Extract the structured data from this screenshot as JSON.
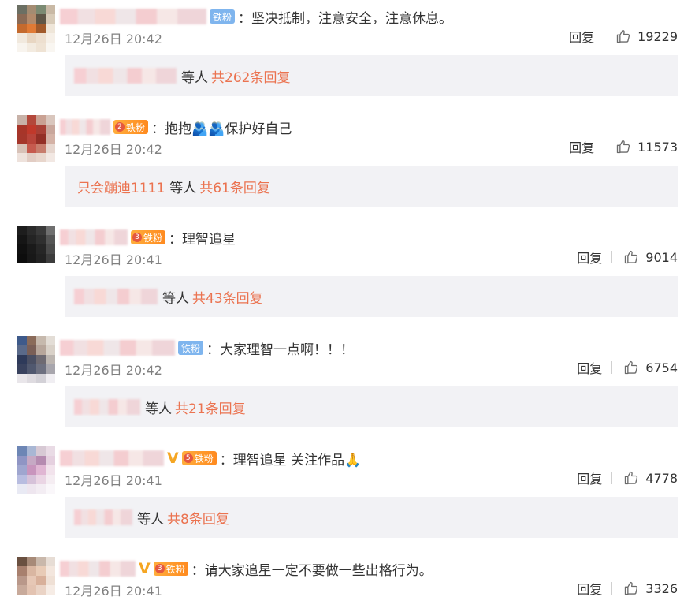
{
  "comments": [
    {
      "fan_label": "铁粉",
      "fan_style": "blue",
      "fan_level": "",
      "vip": "",
      "colon": "：",
      "text": "坚决抵制，注意安全，注意休息。",
      "time": "12月26日 20:42",
      "reply_label": "回复",
      "likes": "19229",
      "sub_nick": "",
      "sub_etc": "等人",
      "sub_total": "共262条回复",
      "avatar_colors": [
        "#6b6f63",
        "#a48c72",
        "#7b8a72",
        "#c9b9a5",
        "#8a6a55",
        "#b28a6b",
        "#5f5647",
        "#d8cbb8",
        "#c46a2e",
        "#e07a35",
        "#a15a2b",
        "#efe6d9",
        "#f1e9de",
        "#e8d6c2",
        "#eddfcf",
        "#f6f0e8",
        "#f8f4ee",
        "#f3ebe0",
        "#efe3d4",
        "#f9f6f1"
      ]
    },
    {
      "fan_label": "铁粉",
      "fan_style": "orange",
      "fan_level": "2",
      "vip": "",
      "colon": "：",
      "text": "抱抱🫂🫂保护好自己",
      "time": "12月26日 20:42",
      "reply_label": "回复",
      "likes": "11573",
      "sub_nick": "只会蹦迪1111",
      "sub_etc": "等人",
      "sub_total": "共61条回复",
      "avatar_colors": [
        "#c8b2a8",
        "#b3483b",
        "#c9a193",
        "#d9c6bd",
        "#a73529",
        "#c0392b",
        "#a84036",
        "#c9a79c",
        "#a5362b",
        "#b8443a",
        "#932f26",
        "#d4b2a6",
        "#d8c2b8",
        "#c65a4e",
        "#c77c6c",
        "#e6d6ce",
        "#eee2dc",
        "#e2cdc4",
        "#e8d6cc",
        "#f2e8e3"
      ]
    },
    {
      "fan_label": "铁粉",
      "fan_style": "orange",
      "fan_level": "3",
      "vip": "",
      "colon": "：",
      "text": "理智追星",
      "time": "12月26日 20:41",
      "reply_label": "回复",
      "likes": "9014",
      "sub_nick": "",
      "sub_etc": "等人",
      "sub_total": "共43条回复",
      "avatar_colors": [
        "#1d1d1d",
        "#2b2b2b",
        "#3a3a3a",
        "#6f6f6f",
        "#151515",
        "#242424",
        "#2f2f2f",
        "#555555",
        "#101010",
        "#1a1a1a",
        "#262626",
        "#4a4a4a",
        "#0d0d0d",
        "#181818",
        "#222222",
        "#3c3c3c",
        "#ffffff",
        "#ffffff",
        "#ffffff",
        "#ffffff"
      ]
    },
    {
      "fan_label": "铁粉",
      "fan_style": "blue",
      "fan_level": "",
      "vip": "",
      "colon": "：",
      "text": "大家理智一点啊！！！",
      "time": "12月26日 20:42",
      "reply_label": "回复",
      "likes": "6754",
      "sub_nick": "",
      "sub_etc": "等人",
      "sub_total": "共21条回复",
      "avatar_colors": [
        "#3e5a8a",
        "#8a6b5a",
        "#c6b9ad",
        "#e3ddd6",
        "#5a6a8a",
        "#7a5f57",
        "#b7a69b",
        "#d9d1c8",
        "#2e3a5a",
        "#4a4f63",
        "#6e6a72",
        "#bcb5b0",
        "#39425e",
        "#50586f",
        "#6d7080",
        "#a8a6ad",
        "#e9e6ea",
        "#dedbe0",
        "#d3d1d7",
        "#f0eef2"
      ]
    },
    {
      "fan_label": "铁粉",
      "fan_style": "orange",
      "fan_level": "5",
      "vip": "V",
      "colon": "：",
      "text": "理智追星 关注作品🙏",
      "time": "12月26日 20:41",
      "reply_label": "回复",
      "likes": "4778",
      "sub_nick": "",
      "sub_etc": "等人",
      "sub_total": "共8条回复",
      "avatar_colors": [
        "#6d86b5",
        "#a9b7d4",
        "#d7c9d4",
        "#e9dbe5",
        "#8f95c4",
        "#c6a9c4",
        "#b58bb0",
        "#e5d0df",
        "#9fa6cf",
        "#c895bd",
        "#e0b6d3",
        "#f2e3ec",
        "#b8bde0",
        "#d6c2d9",
        "#ead5e4",
        "#f5edf2",
        "#e9eaf4",
        "#eee6ef",
        "#f3edf3",
        "#faf7fa"
      ]
    },
    {
      "fan_label": "铁粉",
      "fan_style": "orange",
      "fan_level": "3",
      "vip": "V",
      "colon": "：",
      "text": "请大家追星一定不要做一些出格行为。",
      "time": "12月26日 20:41",
      "reply_label": "回复",
      "likes": "3326",
      "sub_nick": "",
      "sub_etc": "",
      "sub_total": "",
      "avatar_colors": [
        "#6a5040",
        "#a78a78",
        "#c9b8ab",
        "#e7ddd5",
        "#a8806e",
        "#d9b6a1",
        "#e8cbb6",
        "#f3e6dd",
        "#b9988a",
        "#e6c7b5",
        "#d8b09a",
        "#efe0d5",
        "#c8aa9b",
        "#e3c3b1",
        "#ead3c5",
        "#f6ece5",
        "#ffffff",
        "#ffffff",
        "#ffffff",
        "#ffffff"
      ]
    }
  ]
}
